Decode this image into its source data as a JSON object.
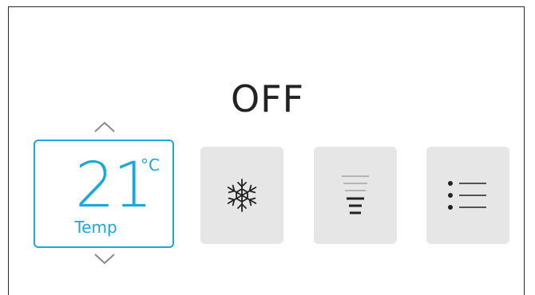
{
  "power": {
    "status": "OFF"
  },
  "temperature": {
    "value": "21",
    "unit": "°C",
    "label": "Temp"
  },
  "controls": [
    {
      "name": "mode",
      "icon": "snowflake-icon"
    },
    {
      "name": "fan-speed",
      "icon": "fan-speed-bars-icon"
    },
    {
      "name": "menu",
      "icon": "list-menu-icon"
    }
  ],
  "colors": {
    "accent": "#1ea7dc",
    "tile_bg": "#e6e6e6",
    "text": "#222222",
    "chevron": "#8a8a8a"
  }
}
